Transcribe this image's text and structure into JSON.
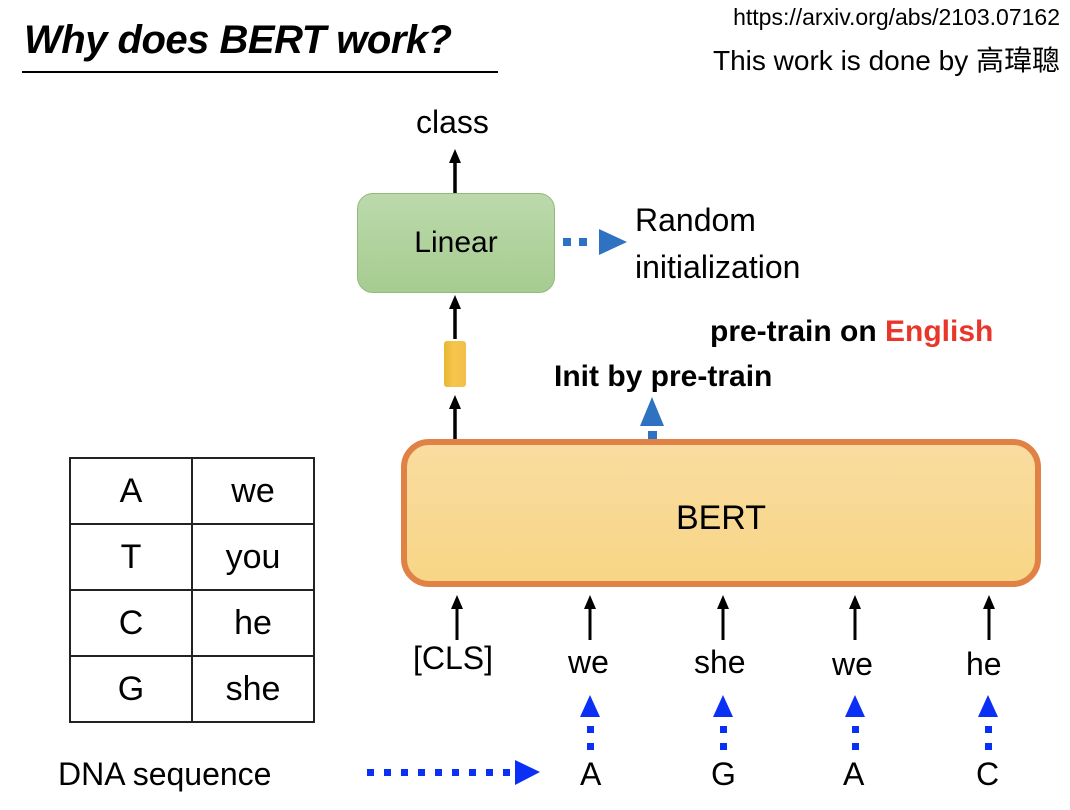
{
  "slide": {
    "title": "Why does BERT work?",
    "reference_url": "https://arxiv.org/abs/2103.07162",
    "credit": "This work is done by 高瑋聰"
  },
  "diagram": {
    "output_label": "class",
    "linear_label": "Linear",
    "random_init_line1": "Random",
    "random_init_line2": "initialization",
    "pretrain_prefix": "pre-train on ",
    "pretrain_language": "English",
    "init_by_pretrain": "Init by pre-train",
    "bert_label": "BERT",
    "cls_token": "[CLS]",
    "tokens": [
      "we",
      "she",
      "we",
      "he"
    ],
    "dna_label": "DNA sequence",
    "dna_bases": [
      "A",
      "G",
      "A",
      "C"
    ]
  },
  "mapping_table": [
    {
      "base": "A",
      "word": "we"
    },
    {
      "base": "T",
      "word": "you"
    },
    {
      "base": "C",
      "word": "he"
    },
    {
      "base": "G",
      "word": "she"
    }
  ],
  "colors": {
    "linear_fill": "#a9cd94",
    "bert_fill": "#f8d890",
    "bert_border": "#e08246",
    "pretrain_arrow": "#2f72c2",
    "dna_arrow": "#0a2ff5",
    "highlight_text": "#e8372a",
    "vector": "#f4c246"
  }
}
